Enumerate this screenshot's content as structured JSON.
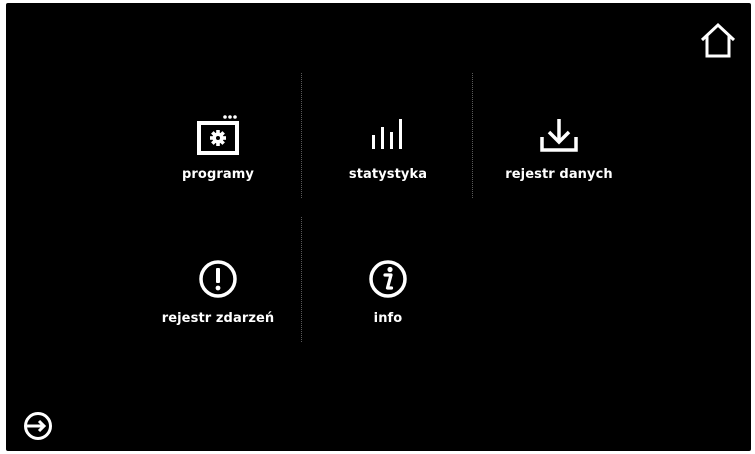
{
  "menu": {
    "items": [
      {
        "label": "programy",
        "icon": "chamber-settings-icon"
      },
      {
        "label": "statystyka",
        "icon": "statistics-bars-icon"
      },
      {
        "label": "rejestr danych",
        "icon": "download-icon"
      },
      {
        "label": "rejestr zdarzeń",
        "icon": "exclamation-circle-icon"
      },
      {
        "label": "info",
        "icon": "info-circle-icon"
      }
    ]
  },
  "nav": {
    "home_icon": "home-icon",
    "logout_icon": "logout-icon"
  },
  "colors": {
    "background": "#000000",
    "foreground": "#ffffff",
    "divider": "#5a5a5a"
  }
}
